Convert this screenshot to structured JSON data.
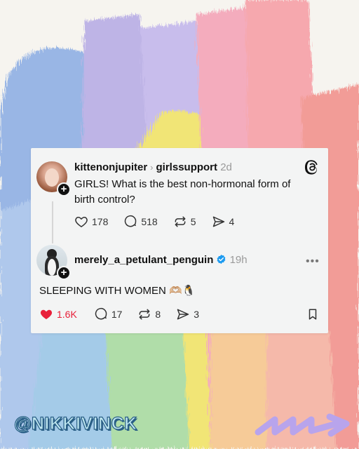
{
  "post": {
    "username": "kittenonjupiter",
    "community": "girlssupport",
    "time": "2d",
    "text": "GIRLS! What is the best non-hormonal form of birth control?",
    "likes": "178",
    "replies": "518",
    "reposts": "5",
    "shares": "4"
  },
  "reply": {
    "username": "merely_a_petulant_penguin",
    "time": "19h",
    "text": "SLEEPING WITH WOMEN 🫶🏼🐧",
    "likes": "1.6K",
    "replies": "17",
    "reposts": "8",
    "shares": "3",
    "liked": true
  },
  "watermark": "@NIKKIVINCK",
  "colors": {
    "like_red": "#e8203a",
    "verified_blue": "#1d9bf0"
  },
  "icons": [
    "threads-logo-icon",
    "heart-icon",
    "comment-icon",
    "repost-icon",
    "share-icon",
    "more-icon",
    "verified-icon",
    "bookmark-icon",
    "plus-icon"
  ]
}
